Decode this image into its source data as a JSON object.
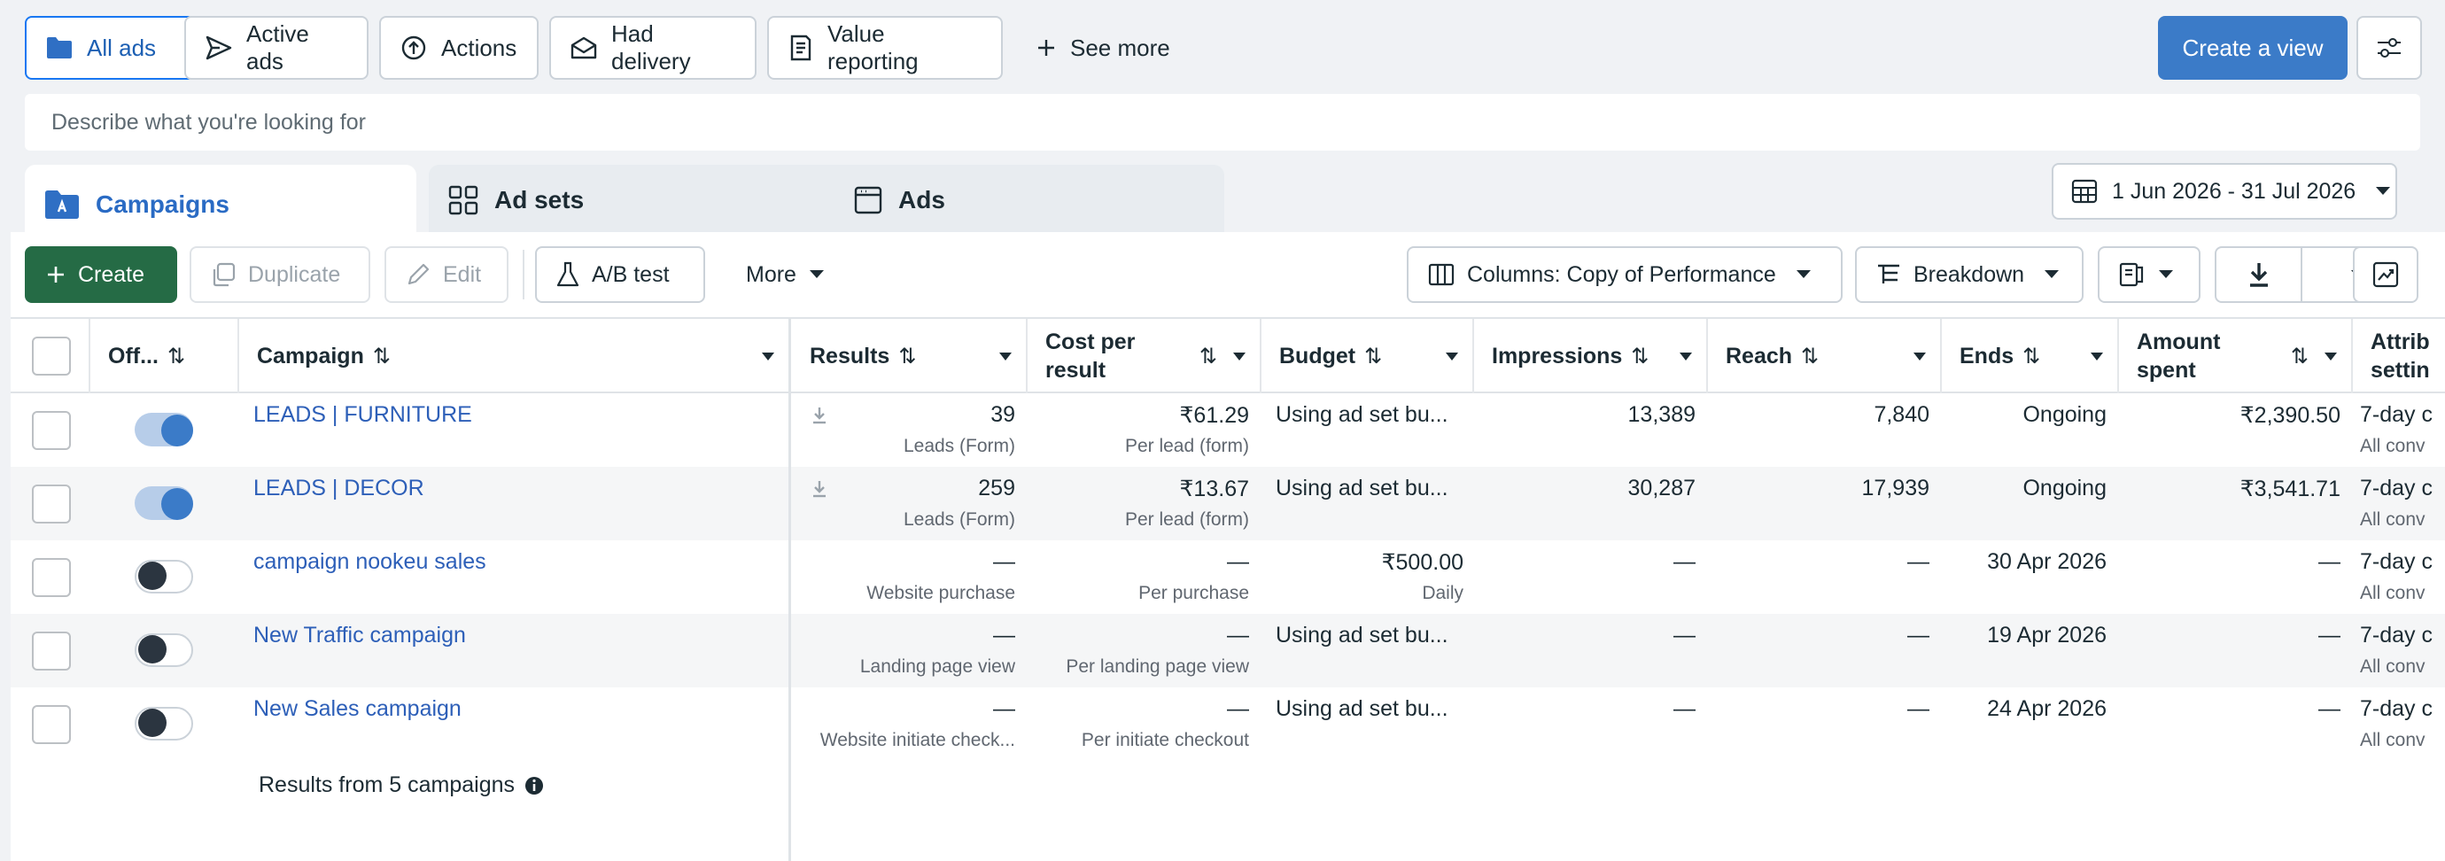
{
  "views": {
    "all_ads": "All ads",
    "active_ads": "Active ads",
    "actions": "Actions",
    "had_delivery": "Had delivery",
    "value_reporting": "Value reporting",
    "see_more": "See more",
    "create_view": "Create a view"
  },
  "search": {
    "placeholder": "Describe what you're looking for"
  },
  "level_tabs": {
    "campaigns": "Campaigns",
    "ad_sets": "Ad sets",
    "ads": "Ads"
  },
  "date_range": "1 Jun 2026 - 31 Jul 2026",
  "toolbar": {
    "create": "Create",
    "duplicate": "Duplicate",
    "edit": "Edit",
    "ab_test": "A/B test",
    "more": "More",
    "columns": "Columns: Copy of Performance",
    "breakdown": "Breakdown"
  },
  "columns": {
    "offon": "Off...",
    "campaign": "Campaign",
    "results": "Results",
    "cost_per_result_1": "Cost per",
    "cost_per_result_2": "result",
    "budget": "Budget",
    "impressions": "Impressions",
    "reach": "Reach",
    "ends": "Ends",
    "amount_spent_1": "Amount",
    "amount_spent_2": "spent",
    "attribution_1": "Attrib",
    "attribution_2": "settin"
  },
  "rows": [
    {
      "name": "LEADS | FURNITURE",
      "on": true,
      "results": "39",
      "results_sub": "Leads (Form)",
      "cpr": "₹61.29",
      "cpr_sub": "Per lead (form)",
      "budget": "Using ad set bu...",
      "budget_sub": "",
      "impressions": "13,389",
      "reach": "7,840",
      "ends": "Ongoing",
      "spent": "₹2,390.50",
      "attr": "7-day c",
      "attr_sub": "All conv"
    },
    {
      "name": "LEADS | DECOR",
      "on": true,
      "results": "259",
      "results_sub": "Leads (Form)",
      "cpr": "₹13.67",
      "cpr_sub": "Per lead (form)",
      "budget": "Using ad set bu...",
      "budget_sub": "",
      "impressions": "30,287",
      "reach": "17,939",
      "ends": "Ongoing",
      "spent": "₹3,541.71",
      "attr": "7-day c",
      "attr_sub": "All conv"
    },
    {
      "name": "campaign nookeu sales",
      "on": false,
      "results": "—",
      "results_sub": "Website purchase",
      "cpr": "—",
      "cpr_sub": "Per purchase",
      "budget": "₹500.00",
      "budget_sub": "Daily",
      "impressions": "—",
      "reach": "—",
      "ends": "30 Apr 2026",
      "spent": "—",
      "attr": "7-day c",
      "attr_sub": "All conv"
    },
    {
      "name": "New Traffic campaign",
      "on": false,
      "results": "—",
      "results_sub": "Landing page view",
      "cpr": "—",
      "cpr_sub": "Per landing page view",
      "budget": "Using ad set bu...",
      "budget_sub": "",
      "impressions": "—",
      "reach": "—",
      "ends": "19 Apr 2026",
      "spent": "—",
      "attr": "7-day c",
      "attr_sub": "All conv"
    },
    {
      "name": "New Sales campaign",
      "on": false,
      "results": "—",
      "results_sub": "Website initiate check...",
      "cpr": "—",
      "cpr_sub": "Per initiate checkout",
      "budget": "Using ad set bu...",
      "budget_sub": "",
      "impressions": "—",
      "reach": "—",
      "ends": "24 Apr 2026",
      "spent": "—",
      "attr": "7-day c",
      "attr_sub": "All conv"
    }
  ],
  "footer": "Results from 5 campaigns",
  "colors": {
    "accent": "#3b7bc8",
    "create_green": "#256b45",
    "link": "#2d5fb8"
  }
}
